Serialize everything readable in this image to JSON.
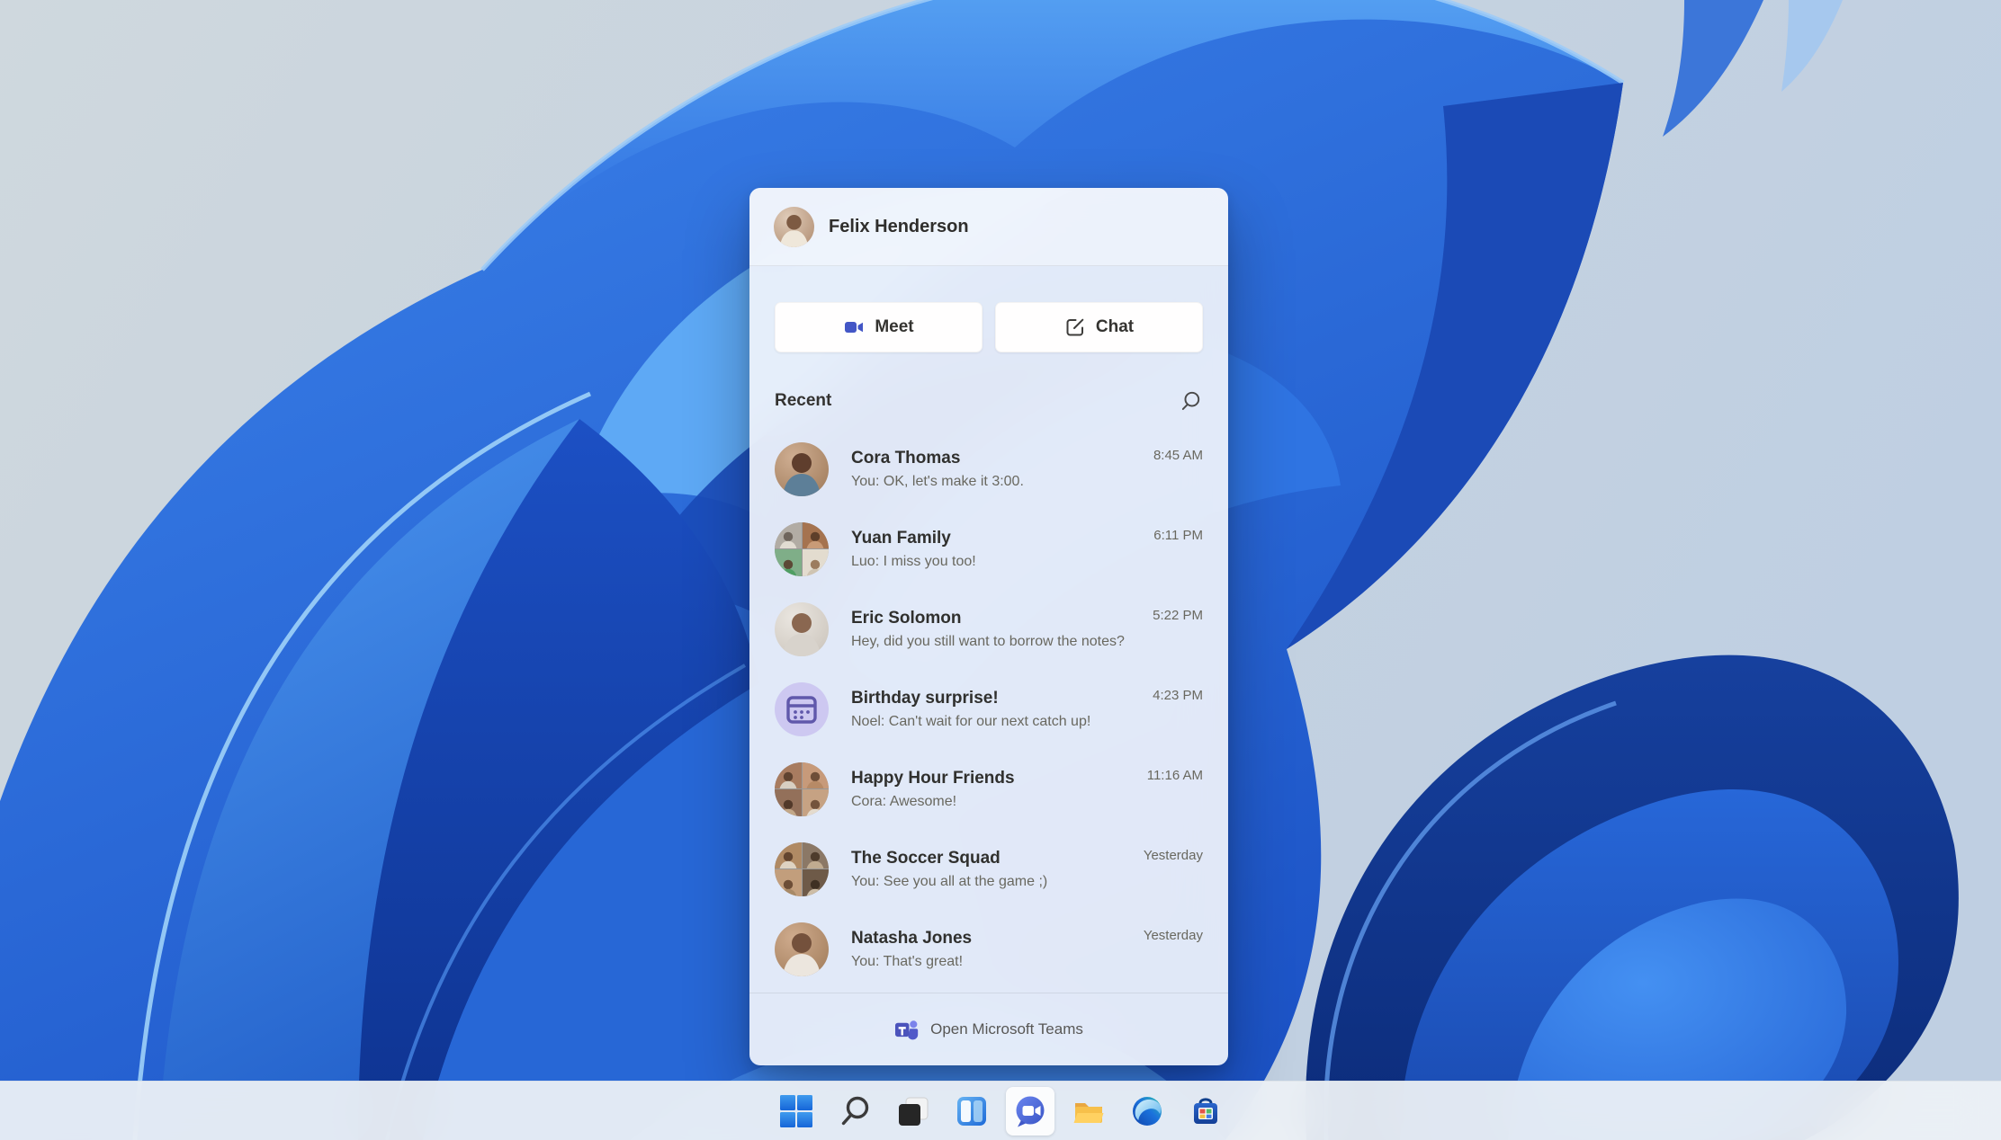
{
  "flyout": {
    "header": {
      "user_name": "Felix Henderson"
    },
    "actions": [
      {
        "id": "meet",
        "label": "Meet",
        "icon": "video-camera-icon"
      },
      {
        "id": "chat",
        "label": "Chat",
        "icon": "compose-icon"
      }
    ],
    "recent_title": "Recent",
    "search_icon": "search-icon",
    "conversations": [
      {
        "name": "Cora Thomas",
        "message": "You: OK, let's make it 3:00.",
        "time": "8:45 AM",
        "avatar": "person-cora"
      },
      {
        "name": "Yuan Family",
        "message": "Luo: I miss you too!",
        "time": "6:11 PM",
        "avatar": "group-yuan"
      },
      {
        "name": "Eric Solomon",
        "message": "Hey, did you still want to borrow the notes?",
        "time": "5:22 PM",
        "avatar": "person-eric"
      },
      {
        "name": "Birthday surprise!",
        "message": "Noel: Can't wait for our next catch up!",
        "time": "4:23 PM",
        "avatar": "calendar"
      },
      {
        "name": "Happy Hour Friends",
        "message": "Cora: Awesome!",
        "time": "11:16 AM",
        "avatar": "group-happy"
      },
      {
        "name": "The Soccer Squad",
        "message": "You: See you all at the game ;)",
        "time": "Yesterday",
        "avatar": "group-soccer"
      },
      {
        "name": "Natasha Jones",
        "message": "You: That's great!",
        "time": "Yesterday",
        "avatar": "person-natasha"
      }
    ],
    "footer": {
      "label": "Open Microsoft Teams",
      "icon": "teams-logo-icon"
    }
  },
  "taskbar": {
    "items": [
      {
        "id": "start",
        "icon": "windows-logo-icon",
        "active": false
      },
      {
        "id": "search",
        "icon": "search-icon",
        "active": false
      },
      {
        "id": "task-view",
        "icon": "task-view-icon",
        "active": false
      },
      {
        "id": "widgets",
        "icon": "widgets-icon",
        "active": false
      },
      {
        "id": "chat",
        "icon": "teams-chat-icon",
        "active": true
      },
      {
        "id": "file-explorer",
        "icon": "folder-icon",
        "active": false
      },
      {
        "id": "edge",
        "icon": "edge-browser-icon",
        "active": false
      },
      {
        "id": "store",
        "icon": "microsoft-store-icon",
        "active": false
      }
    ]
  },
  "colors": {
    "accent_blue": "#2e73e0",
    "panel_bg": "#f0f3fa",
    "taskbar_bg": "#edf1f5",
    "text_primary": "#30302e",
    "text_secondary": "#69685f",
    "meet_icon_blue": "#4356c6",
    "calendar_avatar_bg": "#cdc8f1",
    "calendar_avatar_glyph": "#6058ab",
    "wallpaper_background": "#c7d3df",
    "wallpaper_blue_bright": "#4f9bf2",
    "wallpaper_blue_dark": "#0e3390"
  }
}
